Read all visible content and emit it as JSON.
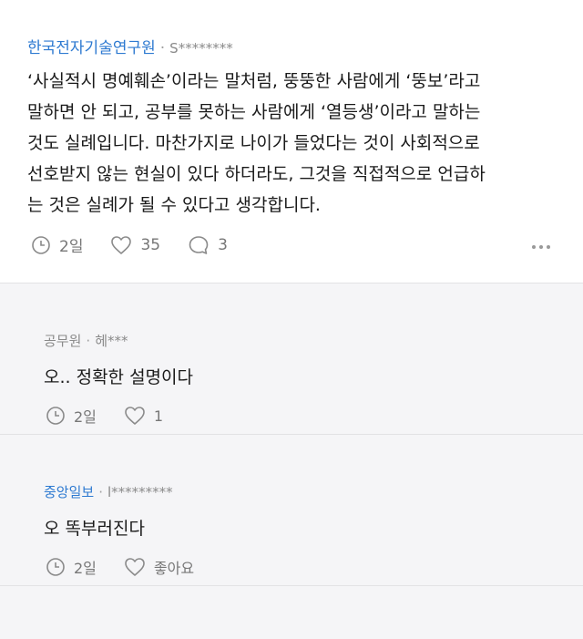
{
  "post": {
    "company": "한국전자기술연구원",
    "separator": "·",
    "user": "S********",
    "lines": [
      "‘사실적시 명예훼손’이라는 말처럼, 뚱뚱한 사람에게 ‘뚱보’라고",
      "말하면 안 되고, 공부를 못하는 사람에게 ‘열등생’이라고 말하는",
      "것도 실례입니다. 마찬가지로 나이가 들었다는 것이 사회적으로",
      "선호받지 않는 현실이 있다 하더라도, 그것을 직접적으로 언급하",
      "는 것은 실례가 될 수 있다고 생각합니다."
    ],
    "time": "2일",
    "likes": "35",
    "comments": "3"
  },
  "comments": [
    {
      "company": "공무원",
      "separator": "·",
      "user": "헤***",
      "text": "오.. 정확한 설명이다",
      "time": "2일",
      "likes": "1"
    },
    {
      "company": "중앙일보",
      "separator": "·",
      "user": "l*********",
      "text": "오 똑부러진다",
      "time": "2일",
      "likes": "좋아요"
    }
  ],
  "colors": {
    "company": "#2e7ad1",
    "comments_bg": "#f5f5f7"
  },
  "icons": [
    "clock-icon",
    "heart-icon",
    "comment-bubble-icon",
    "more-dots-icon"
  ]
}
